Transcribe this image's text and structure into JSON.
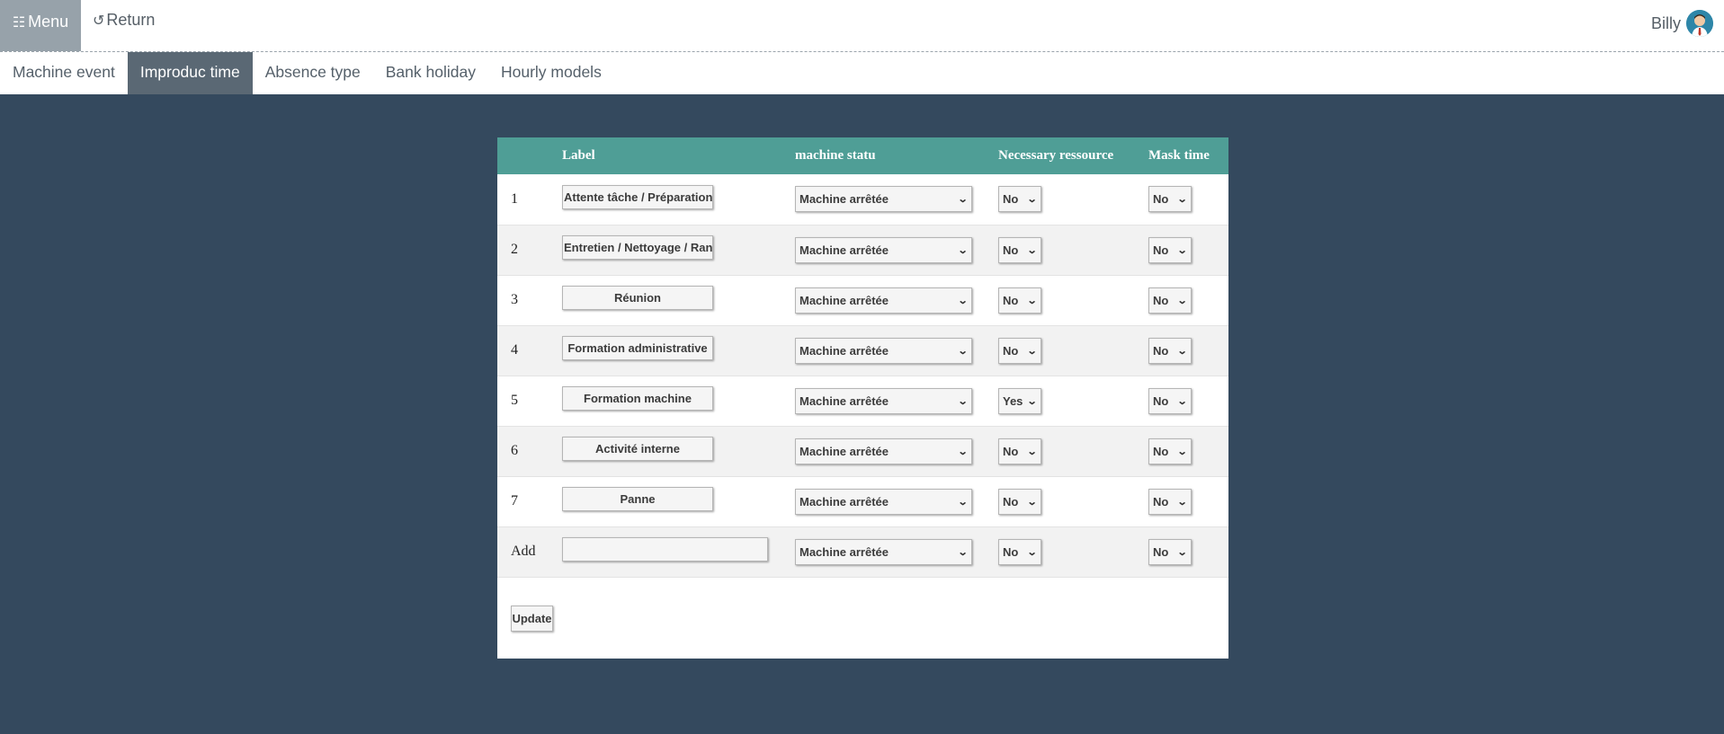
{
  "topbar": {
    "menu_label": "Menu",
    "menu_icon": "list-icon",
    "return_label": "Return",
    "return_icon": "return-icon",
    "user_name": "Billy"
  },
  "tabs": [
    {
      "label": "Machine event",
      "active": false
    },
    {
      "label": "Improduc time",
      "active": true
    },
    {
      "label": "Absence type",
      "active": false
    },
    {
      "label": "Bank holiday",
      "active": false
    },
    {
      "label": "Hourly models",
      "active": false
    }
  ],
  "table": {
    "headers": [
      "",
      "Label",
      "machine statu",
      "Necessary ressource",
      "Mask time"
    ],
    "rows": [
      {
        "num": "1",
        "label": "Attente tâche / Préparation",
        "status": "Machine arrêtée",
        "ressource": "No",
        "mask": "No"
      },
      {
        "num": "2",
        "label": "Entretien / Nettoyage / Rangement",
        "status": "Machine arrêtée",
        "ressource": "No",
        "mask": "No"
      },
      {
        "num": "3",
        "label": "Réunion",
        "status": "Machine arrêtée",
        "ressource": "No",
        "mask": "No"
      },
      {
        "num": "4",
        "label": "Formation administrative",
        "status": "Machine arrêtée",
        "ressource": "No",
        "mask": "No"
      },
      {
        "num": "5",
        "label": "Formation machine",
        "status": "Machine arrêtée",
        "ressource": "Yes",
        "mask": "No"
      },
      {
        "num": "6",
        "label": "Activité interne",
        "status": "Machine arrêtée",
        "ressource": "No",
        "mask": "No"
      },
      {
        "num": "7",
        "label": "Panne",
        "status": "Machine arrêtée",
        "ressource": "No",
        "mask": "No"
      }
    ],
    "add_row": {
      "num": "Add",
      "label": "",
      "status": "Machine arrêtée",
      "ressource": "No",
      "mask": "No"
    }
  },
  "update_label": "Update",
  "colors": {
    "background": "#34495e",
    "header": "#4f9e96",
    "active_tab": "#5a6874",
    "menu": "#97a2aa"
  }
}
